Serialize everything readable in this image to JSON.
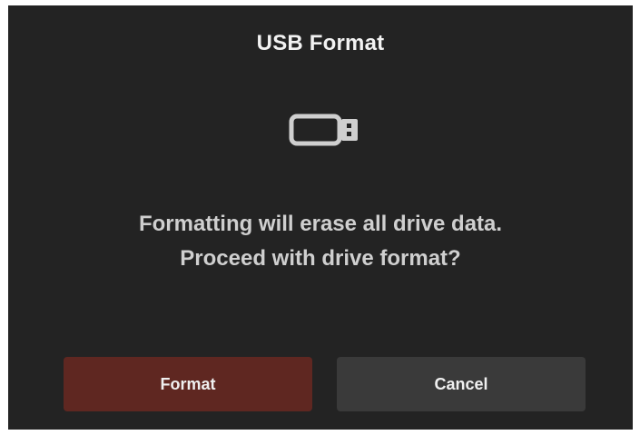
{
  "dialog": {
    "title": "USB Format",
    "icon": "usb-drive-icon",
    "message_line1": "Formatting will erase all drive data.",
    "message_line2": "Proceed with drive format?",
    "buttons": {
      "format_label": "Format",
      "cancel_label": "Cancel"
    }
  },
  "colors": {
    "background": "#232323",
    "format_button": "#5f2721",
    "cancel_button": "#3a3a3a",
    "icon": "#cfcfcf"
  }
}
